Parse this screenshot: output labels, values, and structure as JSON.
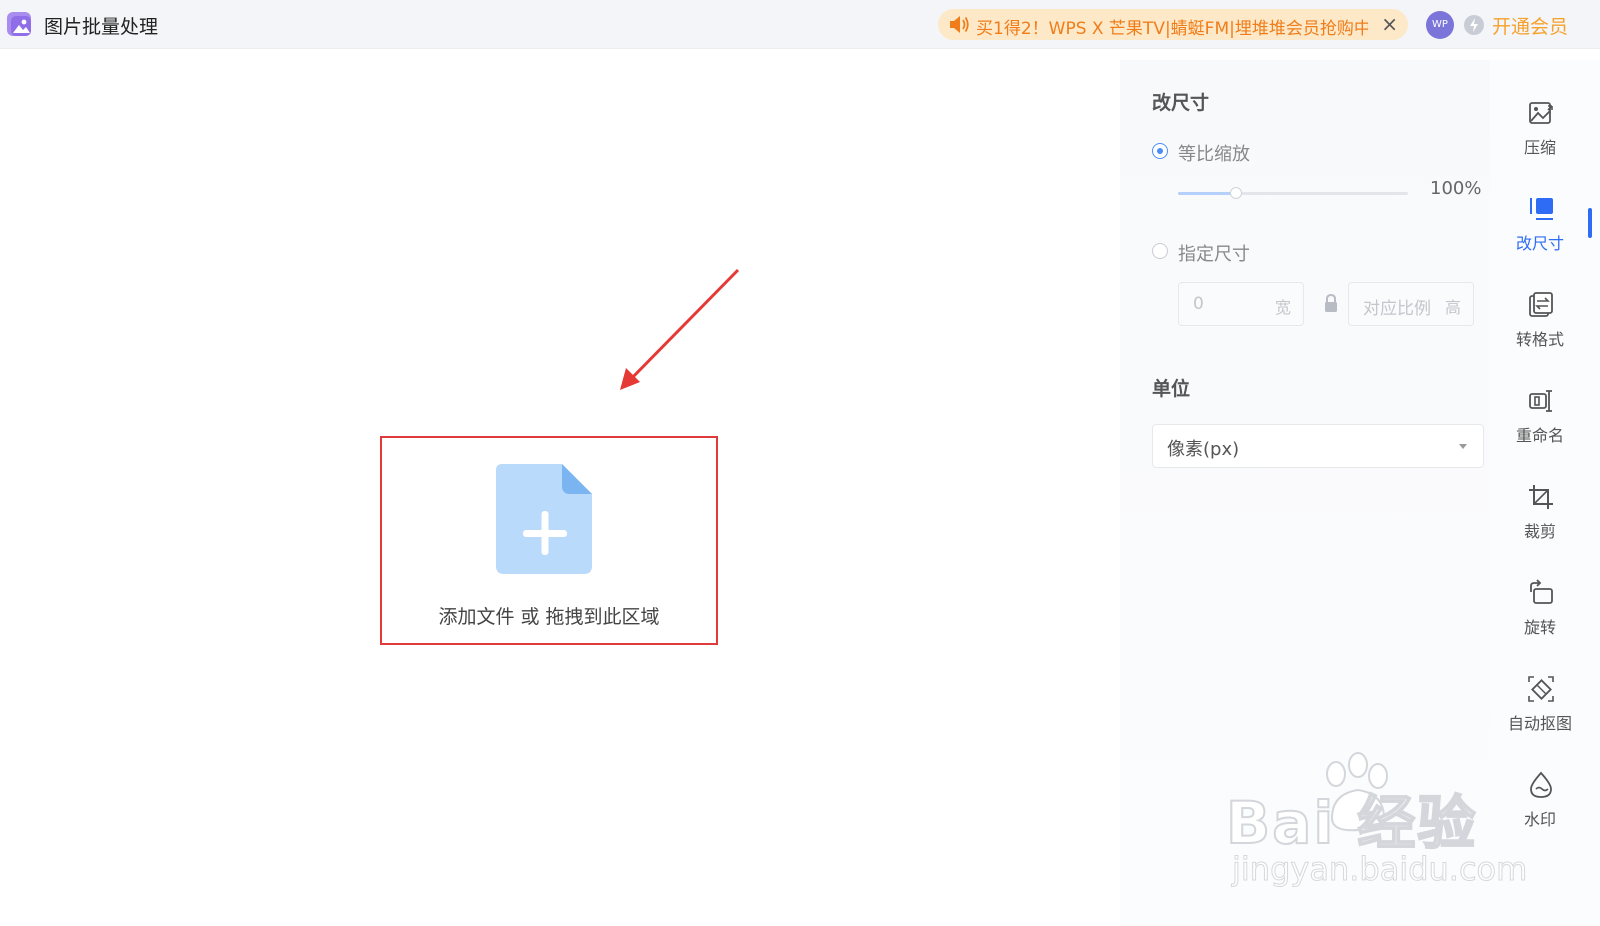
{
  "app": {
    "title": "图片批量处理"
  },
  "header": {
    "promo_text": "买1得2！WPS X 芒果TV|蜻蜓FM|埋堆堆会员抢购中！",
    "promo_close": "×",
    "avatar_text": "WP",
    "vip_label": "开通会员"
  },
  "dropzone": {
    "label": "添加文件 或 拖拽到此区域"
  },
  "settings": {
    "section_title": "改尺寸",
    "scale_option": "等比缩放",
    "scale_value": "100%",
    "scale_fraction": 0.25,
    "custom_option": "指定尺寸",
    "width_value": "0",
    "width_unit": "宽",
    "height_placeholder": "对应比例",
    "height_unit": "高",
    "unit_title": "单位",
    "unit_value": "像素(px)"
  },
  "tools": [
    {
      "label": "压缩",
      "icon": "compress-icon",
      "active": false
    },
    {
      "label": "改尺寸",
      "icon": "resize-icon",
      "active": true
    },
    {
      "label": "转格式",
      "icon": "convert-format-icon",
      "active": false
    },
    {
      "label": "重命名",
      "icon": "rename-icon",
      "active": false
    },
    {
      "label": "裁剪",
      "icon": "crop-icon",
      "active": false
    },
    {
      "label": "旋转",
      "icon": "rotate-icon",
      "active": false
    },
    {
      "label": "自动抠图",
      "icon": "auto-cutout-icon",
      "active": false
    },
    {
      "label": "水印",
      "icon": "watermark-icon",
      "active": false
    }
  ],
  "colors": {
    "accent": "#2f6cf6",
    "promo_text": "#f07d1a",
    "vip": "#f6a12c",
    "highlight_border": "#e03a3a"
  },
  "watermark": {
    "brand": "Bai  经验",
    "url": "jingyan.baidu.com"
  }
}
